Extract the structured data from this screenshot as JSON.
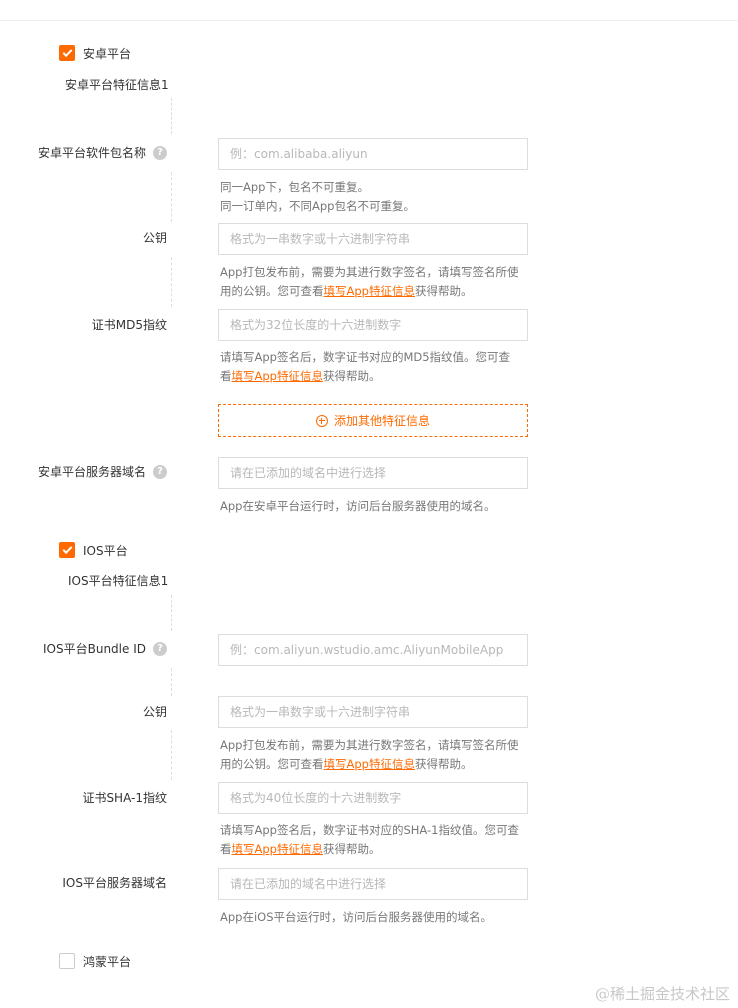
{
  "android": {
    "checkbox_label": "安卓平台",
    "checked": true,
    "section_title": "安卓平台特征信息1",
    "package": {
      "label": "安卓平台软件包名称",
      "placeholder": "例：com.alibaba.aliyun",
      "help_line1": "同一App下，包名不可重复。",
      "help_line2": "同一订单内，不同App包名不可重复。"
    },
    "public_key": {
      "label": "公钥",
      "placeholder": "格式为一串数字或十六进制字符串",
      "help_line1": "App打包发布前，需要为其进行数字签名，请填写签名所使",
      "help_line2_prefix": "用的公钥。您可查看",
      "help_link": "填写App特征信息",
      "help_line2_suffix": "获得帮助。"
    },
    "md5": {
      "label": "证书MD5指纹",
      "placeholder": "格式为32位长度的十六进制数字",
      "help_line1": "请填写App签名后，数字证书对应的MD5指纹值。您可查",
      "help_line2_prefix": "看",
      "help_link": "填写App特征信息",
      "help_line2_suffix": "获得帮助。"
    },
    "add_button_label": "添加其他特征信息",
    "domain": {
      "label": "安卓平台服务器域名",
      "placeholder": "请在已添加的域名中进行选择",
      "help": "App在安卓平台运行时，访问后台服务器使用的域名。"
    }
  },
  "ios": {
    "checkbox_label": "IOS平台",
    "checked": true,
    "section_title": "IOS平台特征信息1",
    "bundle": {
      "label": "IOS平台Bundle ID",
      "placeholder": "例：com.aliyun.wstudio.amc.AliyunMobileApp"
    },
    "public_key": {
      "label": "公钥",
      "placeholder": "格式为一串数字或十六进制字符串",
      "help_line1": "App打包发布前，需要为其进行数字签名，请填写签名所使",
      "help_line2_prefix": "用的公钥。您可查看",
      "help_link": "填写App特征信息",
      "help_line2_suffix": "获得帮助。"
    },
    "sha1": {
      "label": "证书SHA-1指纹",
      "placeholder": "格式为40位长度的十六进制数字",
      "help_line1": "请填写App签名后，数字证书对应的SHA-1指纹值。您可查",
      "help_line2_prefix": "看",
      "help_link": "填写App特征信息",
      "help_line2_suffix": "获得帮助。"
    },
    "domain": {
      "label": "IOS平台服务器域名",
      "placeholder": "请在已添加的域名中进行选择",
      "help": "App在iOS平台运行时，访问后台服务器使用的域名。"
    }
  },
  "harmony": {
    "checkbox_label": "鸿蒙平台",
    "checked": false
  },
  "help_icon_glyph": "?",
  "watermark": "@稀土掘金技术社区",
  "colors": {
    "accent": "#ff6a00",
    "border": "#dddddd",
    "help_text": "#777777",
    "placeholder": "#b8b8b8"
  }
}
